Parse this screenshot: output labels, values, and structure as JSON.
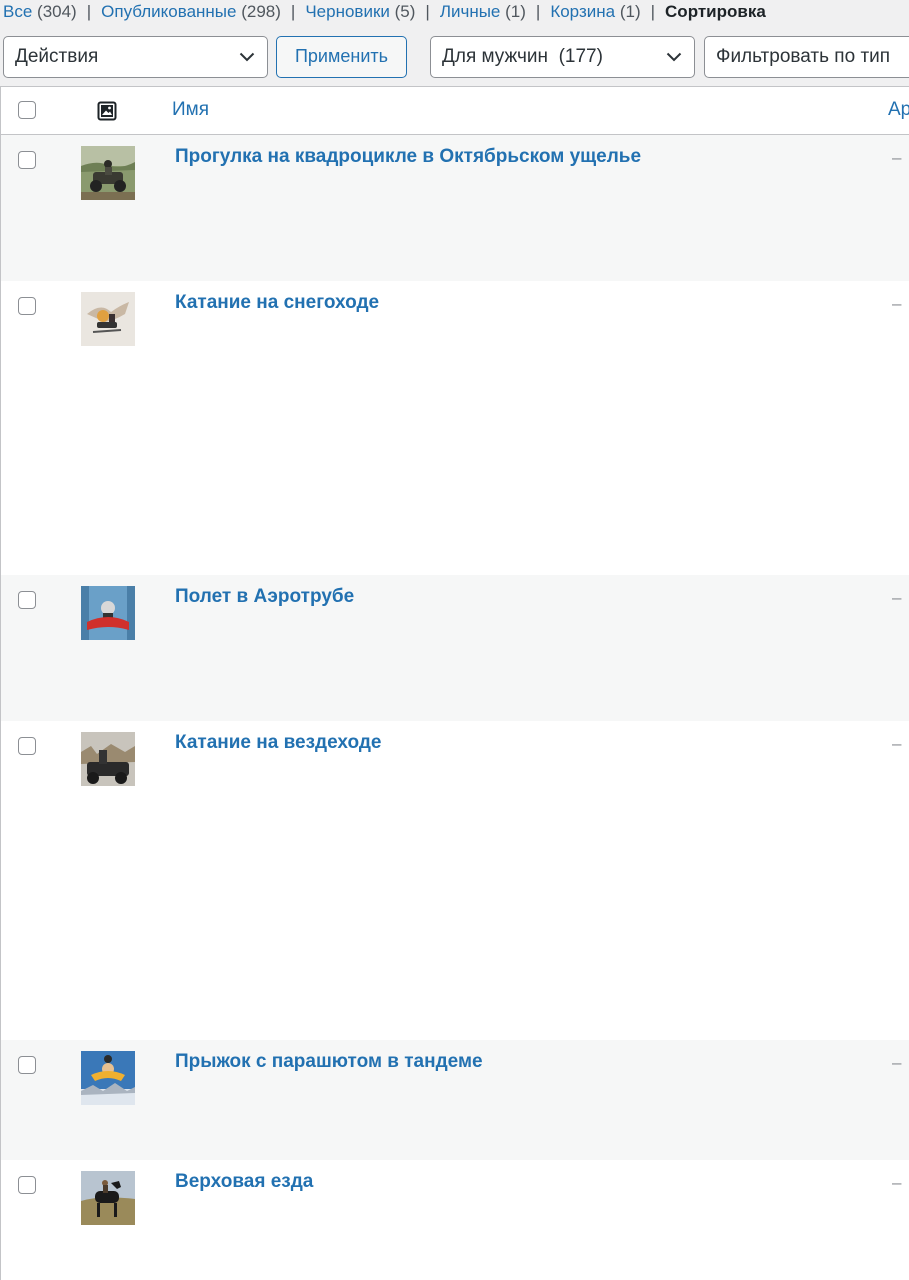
{
  "views": [
    {
      "label": "Все",
      "count": "(304)"
    },
    {
      "label": "Опубликованные",
      "count": "(298)"
    },
    {
      "label": "Черновики",
      "count": "(5)"
    },
    {
      "label": "Личные",
      "count": "(1)"
    },
    {
      "label": "Корзина",
      "count": "(1)"
    }
  ],
  "views_current": "Сортировка",
  "bulk_actions": {
    "selected": "Действия"
  },
  "apply_button": "Применить",
  "category_filter": {
    "selected": "Для мужчин  (177)"
  },
  "type_filter": {
    "selected": "Фильтровать по тип"
  },
  "table": {
    "columns": {
      "name": "Имя",
      "next": "Ар"
    },
    "rows": [
      {
        "title": "Прогулка на квадроцикле в Октябрьском ущелье",
        "dash": "–",
        "thumb_icon": "atv-photo"
      },
      {
        "title": "Катание на снегоходе",
        "dash": "–",
        "thumb_icon": "snowmobile-photo"
      },
      {
        "title": "Полет в Аэротрубе",
        "dash": "–",
        "thumb_icon": "wind-tunnel-photo"
      },
      {
        "title": "Катание на вездеходе",
        "dash": "–",
        "thumb_icon": "all-terrain-vehicle-photo"
      },
      {
        "title": "Прыжок с парашютом в тандеме",
        "dash": "–",
        "thumb_icon": "skydiving-photo"
      },
      {
        "title": "Верховая езда",
        "dash": "–",
        "thumb_icon": "horse-riding-photo"
      }
    ]
  }
}
